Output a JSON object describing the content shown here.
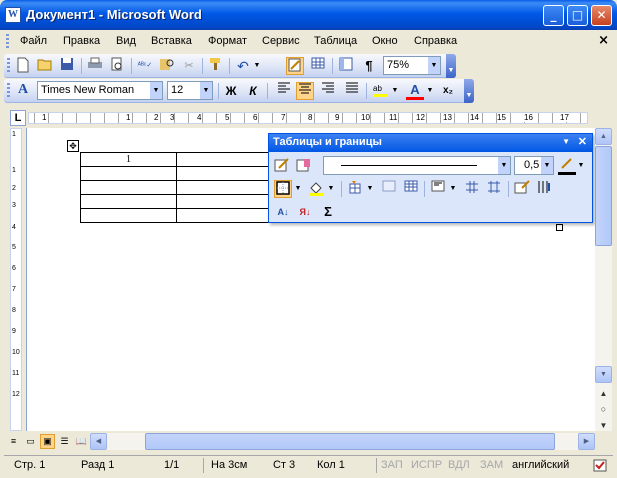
{
  "window": {
    "title": "Документ1 - Microsoft Word",
    "app_icon_glyph": "W"
  },
  "window_controls": {
    "minimize": "_",
    "maximize": "□",
    "close": "✕"
  },
  "menu": {
    "items": [
      "Файл",
      "Правка",
      "Вид",
      "Вставка",
      "Формат",
      "Сервис",
      "Таблица",
      "Окно",
      "Справка"
    ],
    "doc_close": "×"
  },
  "standard_toolbar": {
    "icons": [
      "new-document-icon",
      "open-folder-icon",
      "save-icon",
      "print-icon",
      "print-preview-icon",
      "spelling-icon",
      "research-icon",
      "cut-icon",
      "format-painter-icon",
      "undo-icon",
      "tables-borders-icon",
      "insert-table-icon",
      "document-map-icon",
      "show-formatting-icon"
    ],
    "spelling_glyph": "ᴬᴮᶜ✓",
    "show_formatting_glyph": "¶",
    "zoom": "75%"
  },
  "formatting_toolbar": {
    "style_glyph": "A",
    "font_name": "Times New Roman",
    "font_size": "12",
    "bold": "Ж",
    "italic": "К",
    "font_color_glyph": "A",
    "subscript_glyph": "x₂"
  },
  "ruler": {
    "corner_glyph": "L",
    "h_numbers": [
      "1",
      "1",
      "2",
      "3",
      "4",
      "5",
      "6",
      "7",
      "8",
      "9",
      "10",
      "11",
      "12",
      "13",
      "14",
      "15",
      "16",
      "17"
    ],
    "v_numbers": [
      "1",
      "1",
      "2",
      "3",
      "4",
      "5",
      "6",
      "7",
      "8",
      "9",
      "10",
      "11",
      "12"
    ]
  },
  "document": {
    "table": [
      [
        "1",
        "",
        ""
      ],
      [
        "",
        "",
        ""
      ],
      [
        "",
        "",
        ""
      ],
      [
        "",
        "",
        ""
      ],
      [
        "",
        "",
        ""
      ]
    ],
    "move_handle_glyph": "✥"
  },
  "tables_toolbar": {
    "title": "Таблицы и границы",
    "line_weight": "0,5",
    "sum_glyph": "Σ",
    "sort_asc_glyph": "А↓",
    "sort_desc_glyph": "Я↓"
  },
  "status": {
    "page": "Стр. 1",
    "section": "Разд 1",
    "pages": "1/1",
    "at": "На 3см",
    "line": "Ст 3",
    "col": "Кол 1",
    "rec": "ЗАП",
    "trk": "ИСПР",
    "ext": "ВДЛ",
    "ovr": "ЗАМ",
    "language": "английский"
  },
  "colors": {
    "title_blue": "#0058E6",
    "toolbar_bg": "#DCE4F6",
    "active_button": "#FFD48A",
    "font_color": "#FF0000",
    "highlight": "#FFFF00"
  }
}
